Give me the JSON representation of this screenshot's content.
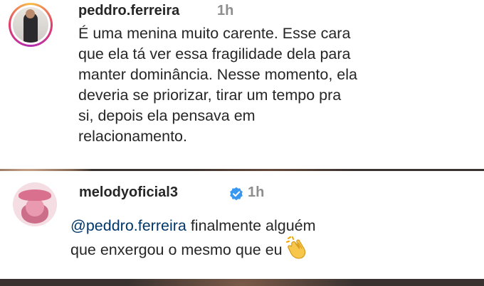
{
  "comments": [
    {
      "username": "peddro.ferreira",
      "timestamp": "1h",
      "verified": false,
      "lines": [
        "É uma menina muito carente. Esse cara",
        "que ela tá ver essa fragilidade dela para",
        "manter dominância. Nesse momento, ela",
        "deveria se priorizar, tirar um tempo pra",
        "si, depois ela pensava em",
        "relacionamento."
      ]
    },
    {
      "username": "melodyoficial3",
      "timestamp": "1h",
      "verified": true,
      "mention": "@peddro.ferreira",
      "line1_rest": " finalmente alguém",
      "line2": "que enxergou o mesmo que eu",
      "emoji": "clapping-hands"
    }
  ],
  "colors": {
    "text": "#262626",
    "muted": "#8e8e8e",
    "mention": "#00376b",
    "verified": "#3897f0"
  }
}
